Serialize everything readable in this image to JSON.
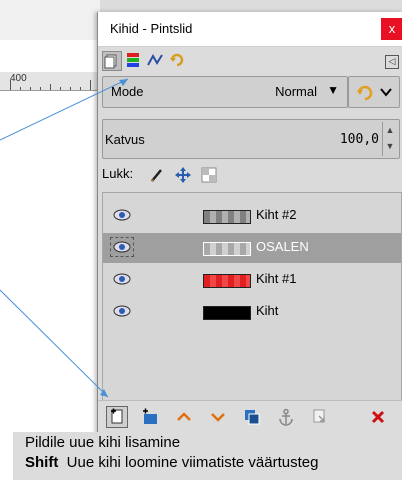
{
  "canvas": {
    "ruler_label": "400"
  },
  "dialog": {
    "title": "Kihid - Pintslid",
    "close_label": "x"
  },
  "tabs": [
    {
      "icon": "layers-icon",
      "selected": true
    },
    {
      "icon": "channels-icon",
      "selected": false
    },
    {
      "icon": "paths-icon",
      "selected": false
    },
    {
      "icon": "undo-history-icon",
      "selected": false
    }
  ],
  "mode": {
    "label": "Mode",
    "value": "Normal"
  },
  "opacity": {
    "label": "Katvus",
    "value": "100,0"
  },
  "lock": {
    "label": "Lukk:"
  },
  "layers": [
    {
      "name": "Kiht #2",
      "thumb_color": "#808080",
      "selected": false
    },
    {
      "name": "OSALEN",
      "thumb_color": "#a8a8a8",
      "selected": true
    },
    {
      "name": "Kiht #1",
      "thumb_color": "#e02020",
      "selected": false
    },
    {
      "name": "Kiht",
      "thumb_color": "#000000",
      "selected": false
    }
  ],
  "toolbar": [
    {
      "icon": "new-layer-icon"
    },
    {
      "icon": "new-layer-group-icon"
    },
    {
      "icon": "raise-layer-icon"
    },
    {
      "icon": "lower-layer-icon"
    },
    {
      "icon": "duplicate-layer-icon"
    },
    {
      "icon": "anchor-layer-icon"
    },
    {
      "icon": "merge-down-icon"
    },
    {
      "icon": "delete-layer-icon"
    }
  ],
  "tooltip": {
    "line1": "Pildile uue kihi lisamine",
    "modifier": "Shift",
    "line2": "Uue kihi loomine viimatiste väärtusteg"
  }
}
